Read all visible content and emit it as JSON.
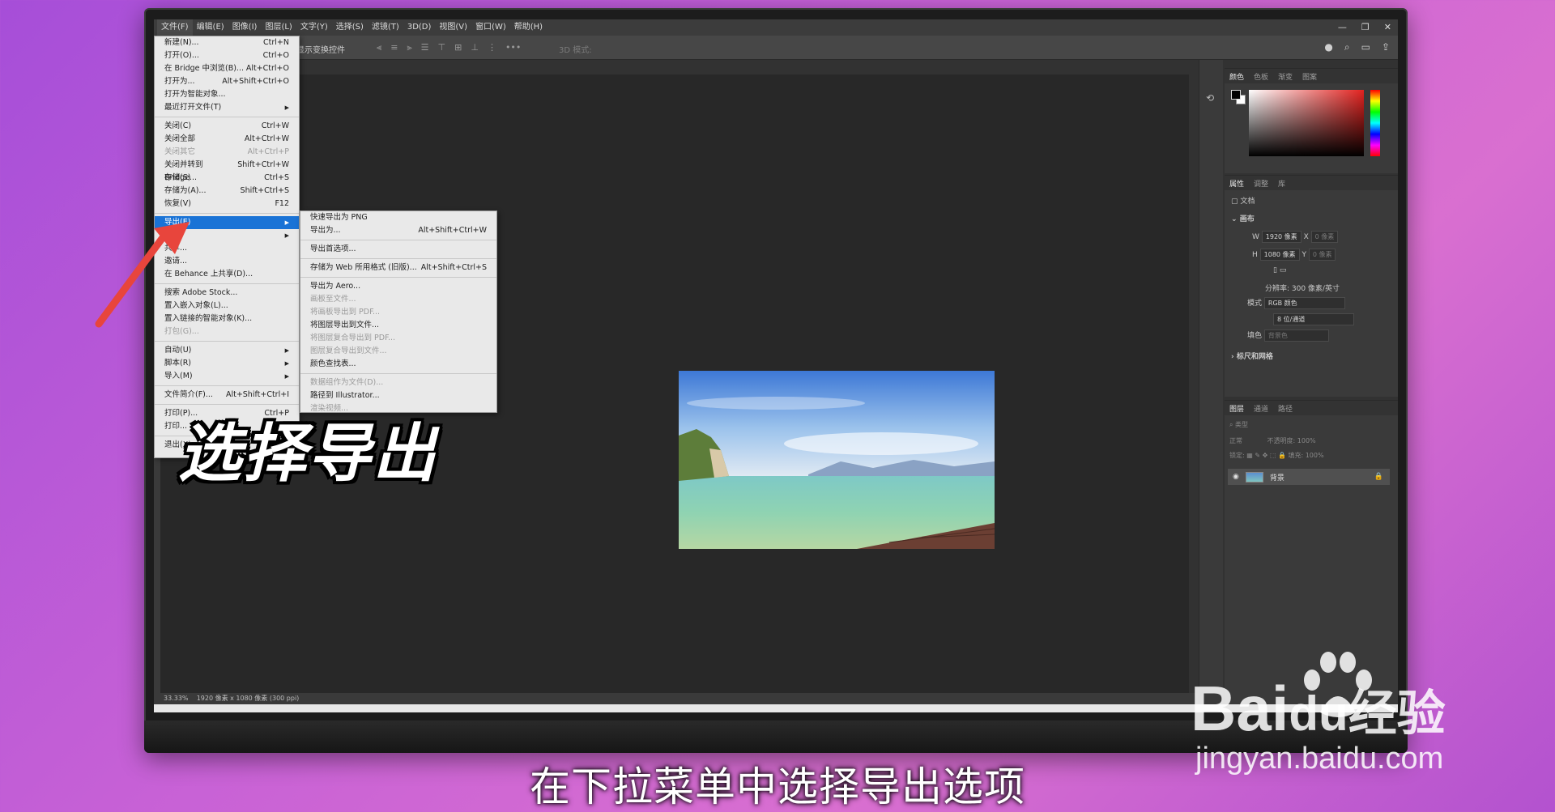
{
  "menubar": {
    "items": [
      "文件(F)",
      "编辑(E)",
      "图像(I)",
      "图层(L)",
      "文字(Y)",
      "选择(S)",
      "滤镜(T)",
      "3D(D)",
      "视图(V)",
      "窗口(W)",
      "帮助(H)"
    ],
    "window_controls": [
      "—",
      "❐",
      "✕"
    ]
  },
  "options_bar": {
    "show_transform": "显示变换控件",
    "mode_3d": "3D 模式:"
  },
  "file_menu": {
    "items": [
      {
        "label": "新建(N)...",
        "shortcut": "Ctrl+N"
      },
      {
        "label": "打开(O)...",
        "shortcut": "Ctrl+O"
      },
      {
        "label": "在 Bridge 中浏览(B)...",
        "shortcut": "Alt+Ctrl+O"
      },
      {
        "label": "打开为...",
        "shortcut": "Alt+Shift+Ctrl+O"
      },
      {
        "label": "打开为智能对象...",
        "shortcut": ""
      },
      {
        "label": "最近打开文件(T)",
        "shortcut": "▶"
      },
      {
        "label": "关闭(C)",
        "shortcut": "Ctrl+W"
      },
      {
        "label": "关闭全部",
        "shortcut": "Alt+Ctrl+W"
      },
      {
        "label": "关闭其它",
        "shortcut": "Alt+Ctrl+P"
      },
      {
        "label": "关闭并转到 Bridge...",
        "shortcut": "Shift+Ctrl+W"
      },
      {
        "label": "存储(S)",
        "shortcut": "Ctrl+S"
      },
      {
        "label": "存储为(A)...",
        "shortcut": "Shift+Ctrl+S"
      },
      {
        "label": "恢复(V)",
        "shortcut": "F12"
      },
      {
        "label": "导出(E)",
        "shortcut": "▶"
      },
      {
        "label": "生成",
        "shortcut": "▶"
      },
      {
        "label": "共享...",
        "shortcut": ""
      },
      {
        "label": "邀请...",
        "shortcut": ""
      },
      {
        "label": "在 Behance 上共享(D)...",
        "shortcut": ""
      },
      {
        "label": "搜索 Adobe Stock...",
        "shortcut": ""
      },
      {
        "label": "置入嵌入对象(L)...",
        "shortcut": ""
      },
      {
        "label": "置入链接的智能对象(K)...",
        "shortcut": ""
      },
      {
        "label": "打包(G)...",
        "shortcut": ""
      },
      {
        "label": "自动(U)",
        "shortcut": "▶"
      },
      {
        "label": "脚本(R)",
        "shortcut": "▶"
      },
      {
        "label": "导入(M)",
        "shortcut": "▶"
      },
      {
        "label": "文件简介(F)...",
        "shortcut": "Alt+Shift+Ctrl+I"
      },
      {
        "label": "打印(P)...",
        "shortcut": "Ctrl+P"
      },
      {
        "label": "打印...",
        "shortcut": ""
      },
      {
        "label": "退出(X)",
        "shortcut": ""
      }
    ]
  },
  "export_submenu": {
    "items": [
      {
        "label": "快速导出为 PNG",
        "shortcut": ""
      },
      {
        "label": "导出为...",
        "shortcut": "Alt+Shift+Ctrl+W"
      },
      {
        "label": "导出首选项...",
        "shortcut": ""
      },
      {
        "label": "存储为 Web 所用格式 (旧版)...",
        "shortcut": "Alt+Shift+Ctrl+S"
      },
      {
        "label": "导出为 Aero...",
        "shortcut": ""
      },
      {
        "label": "画板至文件...",
        "shortcut": ""
      },
      {
        "label": "将画板导出到 PDF...",
        "shortcut": ""
      },
      {
        "label": "将图层导出到文件...",
        "shortcut": ""
      },
      {
        "label": "将图层复合导出到 PDF...",
        "shortcut": ""
      },
      {
        "label": "图层复合导出到文件...",
        "shortcut": ""
      },
      {
        "label": "颜色查找表...",
        "shortcut": ""
      },
      {
        "label": "数据组作为文件(D)...",
        "shortcut": ""
      },
      {
        "label": "路径到 Illustrator...",
        "shortcut": ""
      },
      {
        "label": "渲染视频...",
        "shortcut": ""
      }
    ]
  },
  "status_bar": {
    "zoom": "33.33%",
    "doc_info": "1920 像素 x 1080 像素 (300 ppi)"
  },
  "color_panel": {
    "tabs": [
      "颜色",
      "色板",
      "渐变",
      "图案"
    ]
  },
  "props_panel": {
    "tabs": [
      "属性",
      "调整",
      "库"
    ],
    "doc_label": "文档",
    "canvas_label": "画布",
    "w_label": "W",
    "w_value": "1920 像素",
    "h_label": "H",
    "h_value": "1080 像素",
    "x_label": "X",
    "y_label": "Y",
    "xy_placeholder": "0 像素",
    "resolution": "分辨率: 300 像素/英寸",
    "mode_label": "模式",
    "mode_value": "RGB 颜色",
    "depth_value": "8 位/通道",
    "fill_label": "填色",
    "fill_value": "背景色",
    "rulers_label": "标尺和网格"
  },
  "layers_panel": {
    "tabs": [
      "图层",
      "通道",
      "路径"
    ],
    "search_placeholder": "类型",
    "blend_mode": "正常",
    "opacity_label": "不透明度:",
    "opacity_value": "100%",
    "lock_label": "锁定:",
    "fill_label": "填充:",
    "fill_value": "100%",
    "layer_name": "背景"
  },
  "overlay": {
    "caption": "选择导出",
    "subtitle": "在下拉菜单中选择导出选项",
    "watermark": "Bai",
    "watermark_suffix": "du",
    "watermark_cn": "经验",
    "watermark_url": "jingyan.baidu.com"
  },
  "colors": {
    "highlight": "#1a73d6",
    "arrow": "#e8453c",
    "background_gradient_start": "#a64ed8"
  }
}
